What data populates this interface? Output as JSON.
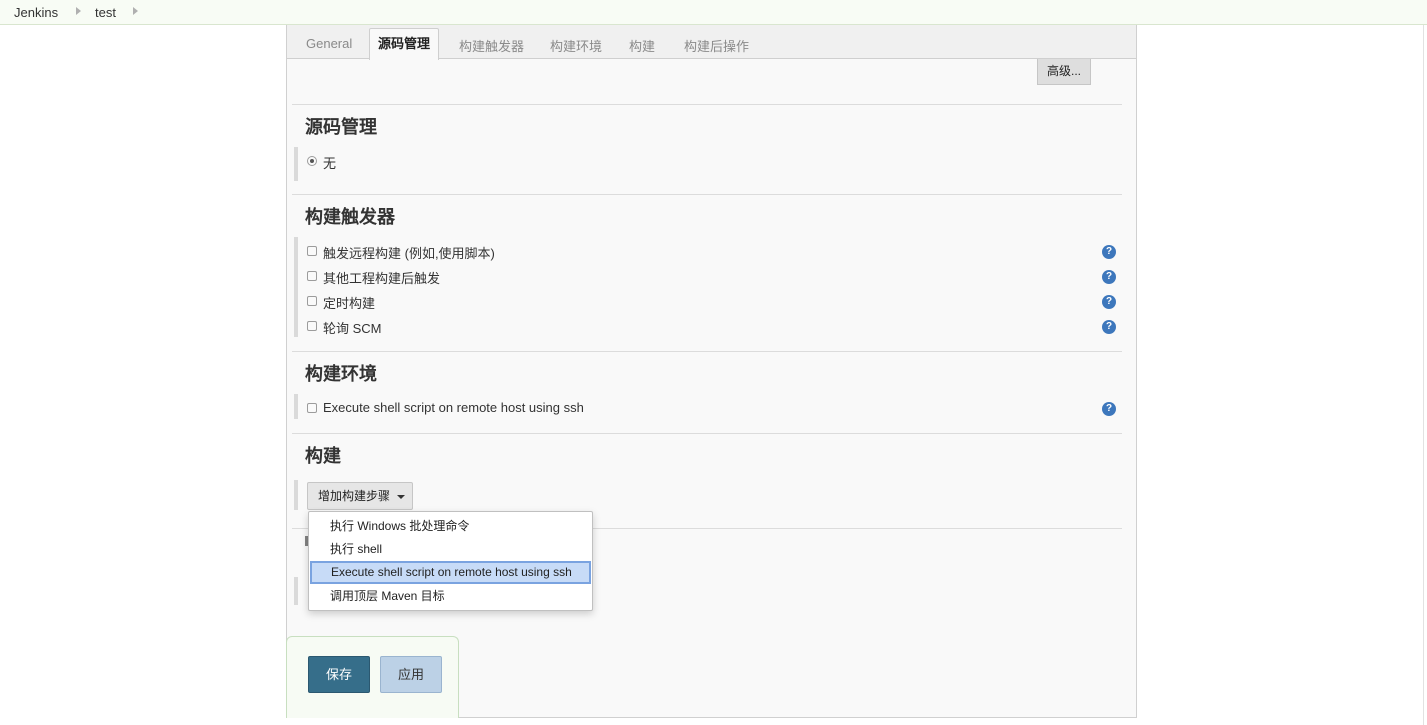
{
  "breadcrumb": {
    "items": [
      "Jenkins",
      "test"
    ]
  },
  "tabs": [
    "General",
    "源码管理",
    "构建触发器",
    "构建环境",
    "构建",
    "构建后操作"
  ],
  "active_tab": "源码管理",
  "advanced_button": "高级...",
  "scm": {
    "title": "源码管理",
    "option_label": "无",
    "selected": true
  },
  "triggers": {
    "title": "构建触发器",
    "options": [
      "触发远程构建 (例如,使用脚本)",
      "其他工程构建后触发",
      "定时构建",
      "轮询 SCM"
    ]
  },
  "build_env": {
    "title": "构建环境",
    "options": [
      "Execute shell script on remote host using ssh"
    ]
  },
  "build": {
    "title": "构建",
    "add_step_label": "增加构建步骤",
    "menu_items": [
      "执行 Windows 批处理命令",
      "执行 shell",
      "Execute shell script on remote host using ssh",
      "调用顶层 Maven 目标"
    ],
    "highlighted_item": "Execute shell script on remote host using ssh"
  },
  "help_icon_glyph": "?",
  "actions": {
    "save_label": "保存",
    "apply_label": "应用"
  },
  "colors": {
    "save_button": "#366e8a",
    "apply_button": "#bcd1e6",
    "help_icon": "#3d77bc",
    "highlight": "#c7dbf7"
  }
}
